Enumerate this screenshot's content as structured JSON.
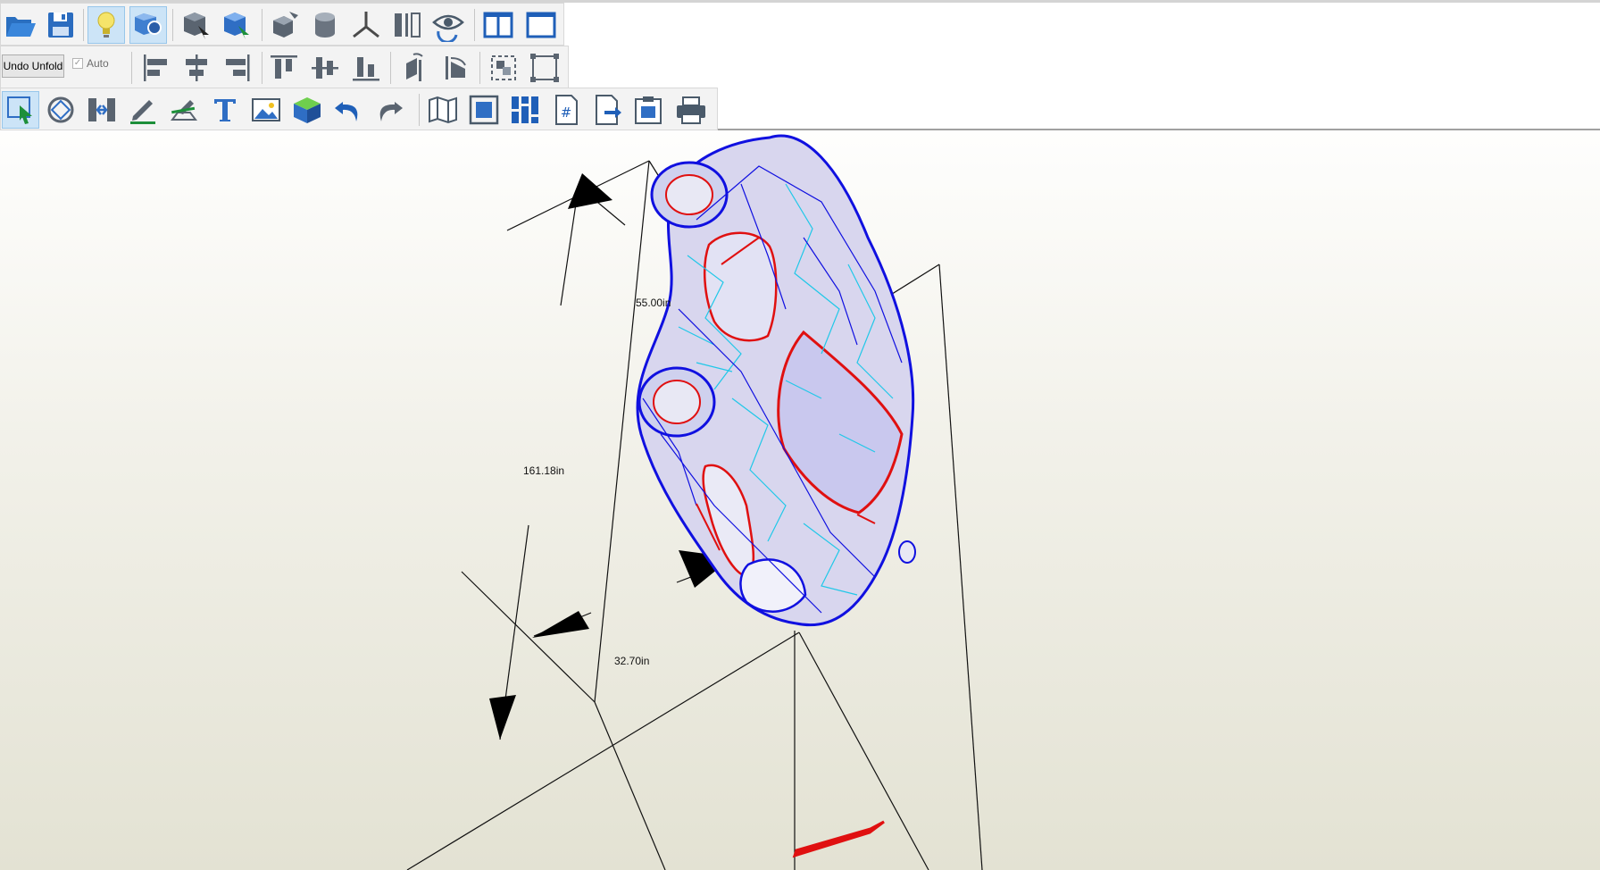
{
  "toolbar": {
    "undo_unfold_label": "Undo Unfold",
    "auto_label": "Auto",
    "auto_checked": true
  },
  "dimensions": {
    "height_label": "55.00in",
    "length_label": "161.18in",
    "width_label": "32.70in"
  },
  "colors": {
    "mesh_blue": "#1010e0",
    "mesh_cyan": "#20c8e8",
    "cut_red": "#e01010",
    "background_top": "#fefefd",
    "background_bottom": "#e3e2d3",
    "active_button": "#cce4f7"
  }
}
